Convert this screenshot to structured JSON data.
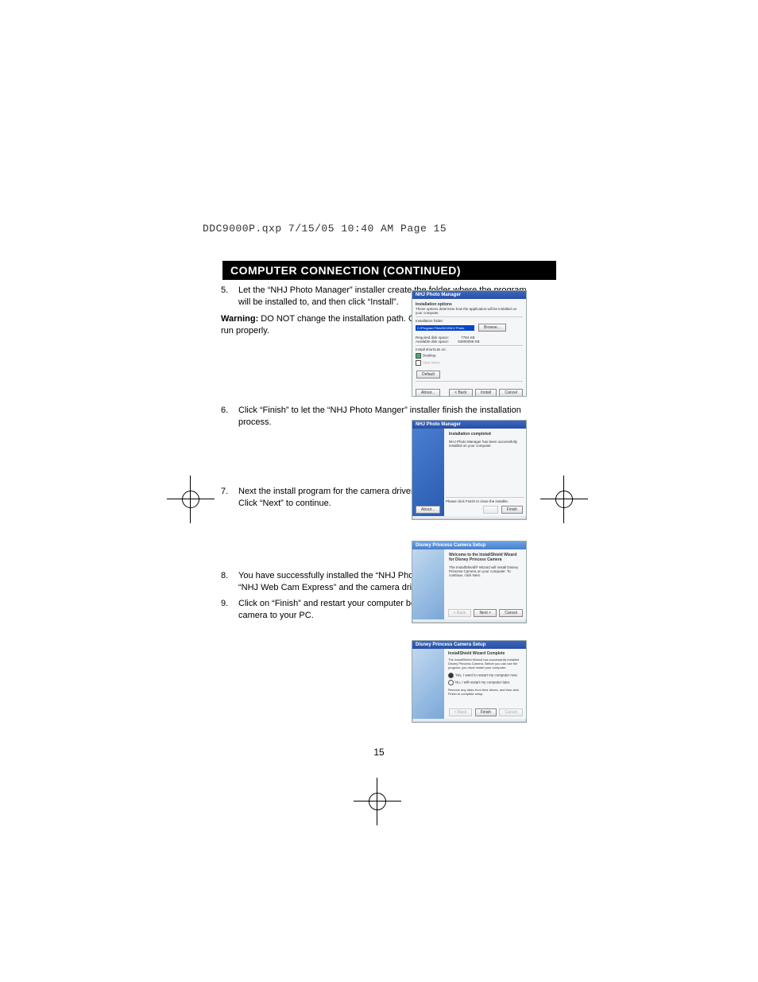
{
  "header": "DDC9000P.qxp  7/15/05  10:40 AM  Page 15",
  "title": "COMPUTER CONNECTION (CONTINUED)",
  "page_number": "15",
  "steps": {
    "s5_num": "5.",
    "s5_text": "Let the “NHJ Photo Manager” installer create the folder where the program will be installed to, and then click “Install”.",
    "s5_warn_label": "Warning:",
    "s5_warn_text": " DO NOT change the installation path. Otherwise, the driver may not run properly.",
    "s6_num": "6.",
    "s6_text": "Click “Finish” to let the “NHJ Photo Manger” installer finish the installation process.",
    "s7_num": "7.",
    "s7_text": "Next the install program for the camera driver will automatically launch. Click “Next” to continue.",
    "s8_num": "8.",
    "s8_text": "You have successfully installed the “NHJ Photo Manager” software, the “NHJ Web Cam Express” and the camera driver.",
    "s9_num": "9.",
    "s9_text": "Click on “Finish” and restart your computer before you connect your camera to your PC."
  },
  "shot1": {
    "title": "NHJ Photo Manager",
    "heading": "Installation options",
    "sub": "These options determine how the application will be installed on your computer.",
    "folder_label": "Installation folder:",
    "folder_value": "C:\\Program Files\\NHJ\\NHJ Photo",
    "browse": "Browse...",
    "req_label": "Required disk space:",
    "req_val": "7784 KB",
    "avail_label": "Available disk space:",
    "avail_val": "63800096 KB",
    "shortcuts": "Install shortcuts on:",
    "cb_desktop": "Desktop",
    "cb_start": "Start Menu",
    "default": "Default",
    "about": "About...",
    "back": "< Back",
    "install": "Install",
    "cancel": "Cancel"
  },
  "shot2": {
    "title": "NHJ Photo Manager",
    "heading": "Installation completed",
    "body": "NHJ Photo Manager has been successfully installed on your computer.",
    "hint": "Please click Finish to close the installer.",
    "about": "About...",
    "finish": "Finish"
  },
  "shot3": {
    "title": "Disney Princess Camera Setup",
    "heading": "Welcome to the InstallShield Wizard for Disney Princess Camera",
    "body": "The InstallShield® Wizard will install Disney Princess Camera on your computer. To continue, click Next.",
    "back": "< Back",
    "next": "Next >",
    "cancel": "Cancel"
  },
  "shot4": {
    "title": "Disney Princess Camera Setup",
    "heading": "InstallShield Wizard Complete",
    "body": "The InstallShield Wizard has successfully installed Disney Princess Camera. Before you can use the program, you must restart your computer.",
    "opt1": "Yes, I want to restart my computer now.",
    "opt2": "No, I will restart my computer later.",
    "hint": "Remove any disks from their drives, and then click Finish to complete setup.",
    "back": "< Back",
    "finish": "Finish",
    "cancel": "Cancel"
  }
}
